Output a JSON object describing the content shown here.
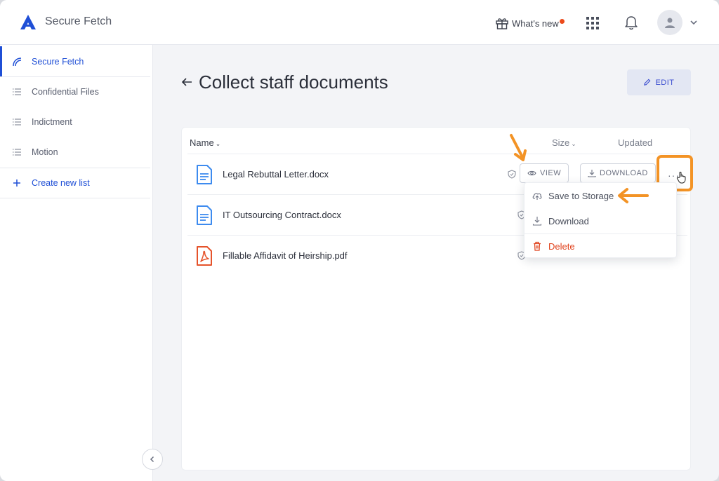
{
  "app": {
    "title": "Secure Fetch"
  },
  "topbar": {
    "whats_new": "What's new"
  },
  "sidebar": {
    "items": [
      {
        "label": "Secure Fetch",
        "icon": "secure-fetch-icon",
        "active": true
      },
      {
        "label": "Confidential Files",
        "icon": "list-icon"
      },
      {
        "label": "Indictment",
        "icon": "list-icon"
      },
      {
        "label": "Motion",
        "icon": "list-icon"
      }
    ],
    "create_label": "Create new list"
  },
  "main": {
    "title": "Collect staff documents",
    "edit_label": "EDIT",
    "table": {
      "columns": {
        "name": "Name",
        "size": "Size",
        "updated": "Updated"
      },
      "rows": [
        {
          "name": "Legal Rebuttal Letter.docx",
          "type": "doc"
        },
        {
          "name": "IT Outsourcing Contract.docx",
          "type": "doc"
        },
        {
          "name": "Fillable Affidavit of Heirship.pdf",
          "type": "pdf"
        }
      ],
      "actions": {
        "view": "VIEW",
        "download": "DOWNLOAD",
        "more": "···"
      }
    },
    "menu": {
      "items": [
        {
          "label": "Save to Storage",
          "icon": "cloud-upload-icon"
        },
        {
          "label": "Download",
          "icon": "download-icon"
        },
        {
          "label": "Delete",
          "icon": "trash-icon"
        }
      ]
    }
  },
  "colors": {
    "accent": "#1f4fd6",
    "annotation": "#f39325",
    "danger": "#e0421c",
    "doc_icon": "#3d8bef",
    "pdf_icon": "#e5532b"
  }
}
